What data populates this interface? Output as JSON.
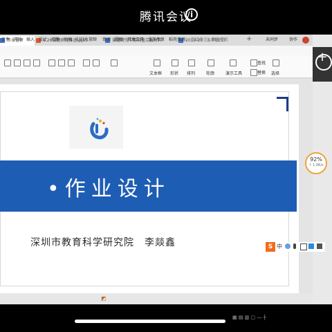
{
  "meeting": {
    "title": "腾讯会议",
    "info_icon": "ⓘ"
  },
  "tabs": [
    {
      "label": "作业设计"
    },
    {
      "label": "6.26课题研究推进.pptx"
    },
    {
      "label": "课题研究中期检查汇报材料"
    },
    {
      "label": "2019-20...五年级(1)"
    }
  ],
  "new_tab": "+",
  "menu": [
    "文件",
    "开始",
    "插入",
    "设计",
    "切换",
    "动画",
    "幻灯片放映",
    "审阅",
    "视图",
    "开发工具",
    "会员专享",
    "稻壳资源",
    "查找命令、搜索模板"
  ],
  "menu_right": [
    "未同步",
    "协作"
  ],
  "toolbar": [
    "文本框",
    "形状",
    "排列",
    "轮廓",
    "演示工具",
    "查找",
    "替换",
    "选择"
  ],
  "plus_button": "+",
  "slide": {
    "title": "•作业设计",
    "subtitle": "深圳市教育科学研究院　李燚鑫"
  },
  "progress": {
    "percent": "92%",
    "sub": "↑ 1.0K/s",
    "value": 0.92
  },
  "ime": {
    "logo": "S",
    "mode": "中"
  },
  "colors": {
    "band": "#1e5db4",
    "accent": "#f2a23a",
    "ime": "#f26b1d"
  }
}
